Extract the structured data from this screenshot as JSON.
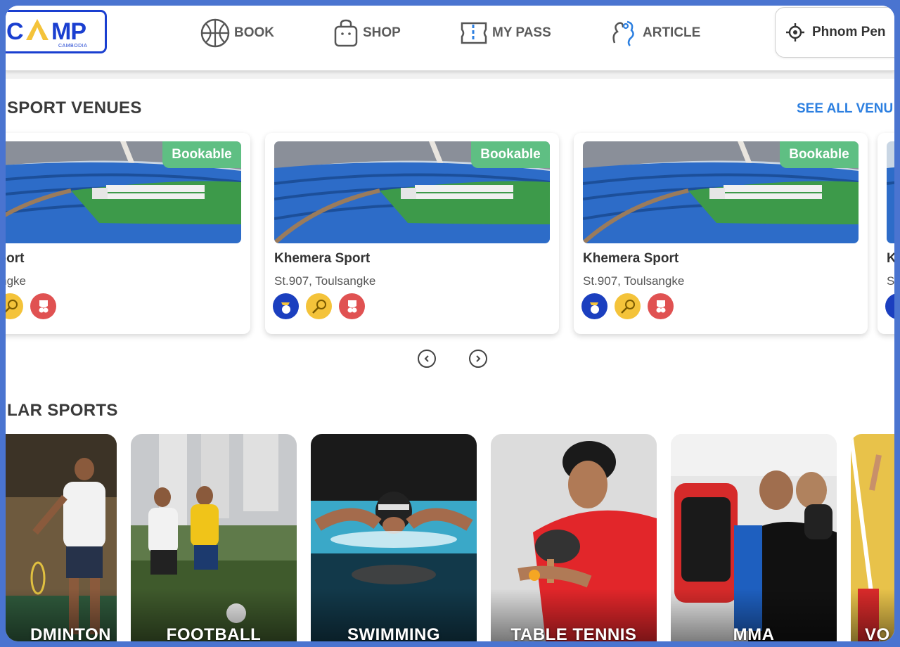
{
  "header": {
    "logo": {
      "left": "C",
      "right": "MP",
      "sub": "CAMBODIA"
    },
    "nav": [
      {
        "label": "BOOK",
        "icon": "basketball-icon"
      },
      {
        "label": "SHOP",
        "icon": "shopping-bag-icon"
      },
      {
        "label": "MY PASS",
        "icon": "ticket-icon"
      },
      {
        "label": "ARTICLE",
        "icon": "article-icon"
      }
    ],
    "location": {
      "label": "Phnom Pen",
      "icon": "location-target-icon"
    }
  },
  "venues": {
    "title": "SPORT VENUES",
    "see_all": "SEE ALL VENU",
    "cards": [
      {
        "badge": "Bookable",
        "name": "era Sport",
        "address": "Toulsangke"
      },
      {
        "badge": "Bookable",
        "name": "Khemera Sport",
        "address": "St.907, Toulsangke"
      },
      {
        "badge": "Bookable",
        "name": "Khemera Sport",
        "address": "St.907, Toulsangke"
      },
      {
        "badge": "",
        "name": "K",
        "address": "S"
      }
    ]
  },
  "popular": {
    "title": "LAR SPORTS",
    "tiles": [
      {
        "label": "DMINTON"
      },
      {
        "label": "FOOTBALL"
      },
      {
        "label": "SWIMMING"
      },
      {
        "label": "TABLE TENNIS"
      },
      {
        "label": "MMA"
      },
      {
        "label": "VO"
      }
    ]
  },
  "colors": {
    "accent": "#2c7fe0",
    "brand": "#1a3fd0",
    "badge": "#5fbf83",
    "frame": "#4a74d0"
  }
}
